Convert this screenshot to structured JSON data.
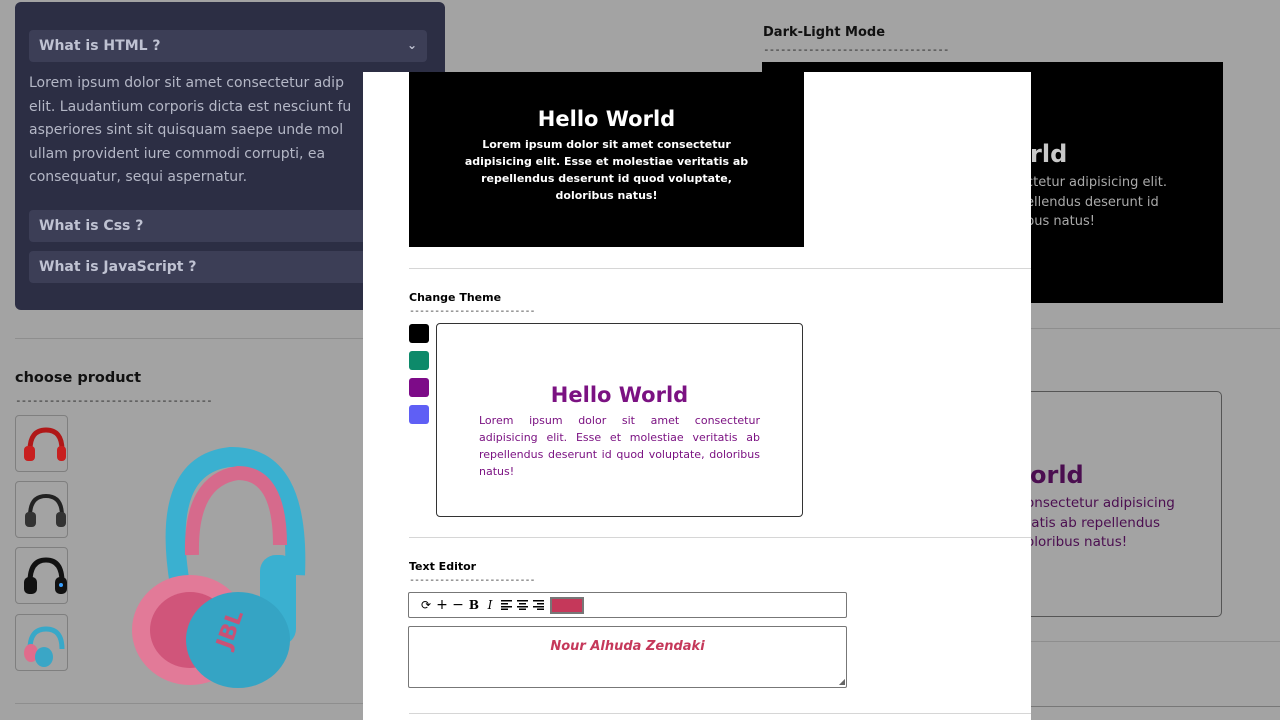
{
  "background": {
    "faq": {
      "q1": "What is HTML ?",
      "answer": "Lorem ipsum dolor sit amet consectetur adip\nelit. Laudantium corporis dicta est nesciunt fu\nasperiores sint sit quisquam saepe unde mol\nullam provident iure commodi corrupti, ea\nconsequatur, sequi aspernatur.",
      "q2": "What is Css ?",
      "q3": "What is JavaScript ?"
    },
    "product_title": "choose product",
    "dark_light_title": "Dark-Light Mode",
    "dark_world_partial": "rld",
    "dark_text_partial": "ctetur adipisicing elit.\nellendus deserunt id\nbus natus!",
    "theme_world_partial": "orld",
    "theme_text_partial": "onsectetur adipisicing\ntatis ab repellendus\noloribus natus!"
  },
  "modal": {
    "dark_demo": {
      "title": "Hello World",
      "text": "Lorem ipsum dolor sit amet consectetur adipisicing elit. Esse et molestiae veritatis ab repellendus deserunt id quod voluptate, doloribus natus!"
    },
    "theme_section": {
      "title": "Change Theme",
      "dashes": "-------------------------",
      "swatches": [
        "#000000",
        "#0d8a6a",
        "#7d0b88",
        "#5f5ff5"
      ],
      "demo_title": "Hello World",
      "demo_text": "Lorem ipsum dolor sit amet consectetur adipisicing elit. Esse et molestiae veritatis ab repellendus deserunt id quod voluptate, doloribus natus!",
      "demo_color": "#7b1282"
    },
    "editor_section": {
      "title": "Text Editor",
      "dashes": "-------------------------",
      "tools": [
        "refresh-icon",
        "plus-icon",
        "minus-icon",
        "bold-icon",
        "italic-icon",
        "align-left-icon",
        "align-center-icon",
        "align-right-icon"
      ],
      "color": "#c5385a",
      "text": "Nour Alhuda Zendaki"
    }
  }
}
